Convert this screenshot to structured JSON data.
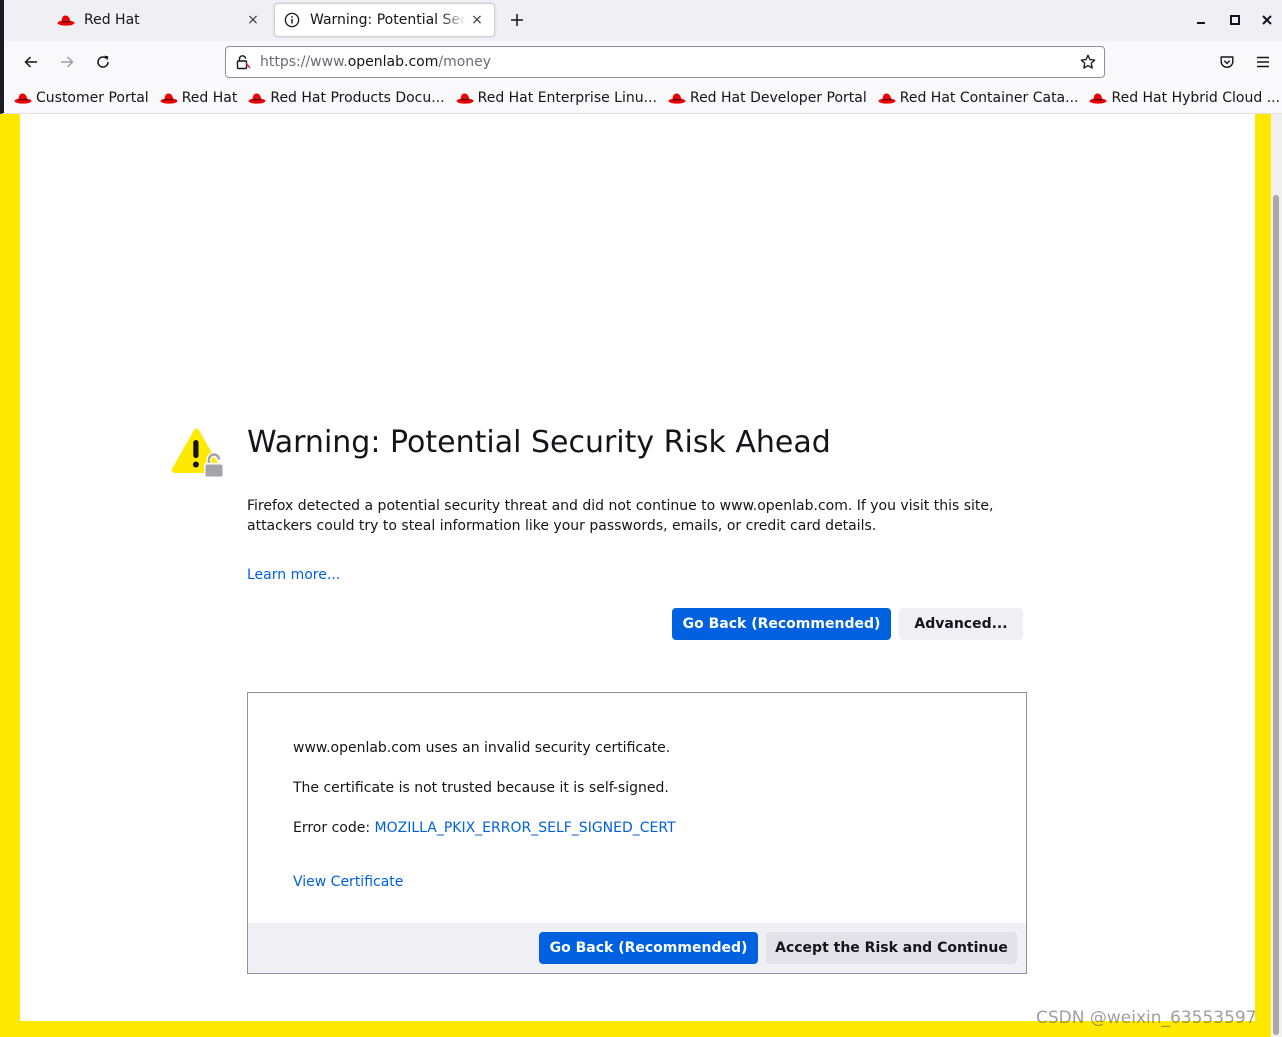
{
  "tabs": [
    {
      "title": "Red Hat",
      "favicon": "redhat-icon",
      "close": "×"
    },
    {
      "title": "Warning: Potential Security Risk Ahead",
      "favicon": "info-icon",
      "close": "×"
    }
  ],
  "toolbar": {
    "url_prefix": "https://www.",
    "url_domain": "openlab.com",
    "url_path": "/money"
  },
  "bookmarks": [
    {
      "label": "Customer Portal"
    },
    {
      "label": "Red Hat"
    },
    {
      "label": "Red Hat Products Docu..."
    },
    {
      "label": "Red Hat Enterprise Linu..."
    },
    {
      "label": "Red Hat Developer Portal"
    },
    {
      "label": "Red Hat Container Cata..."
    },
    {
      "label": "Red Hat Hybrid Cloud ..."
    }
  ],
  "page": {
    "title": "Warning: Potential Security Risk Ahead",
    "description": "Firefox detected a potential security threat and did not continue to www.openlab.com. If you visit this site, attackers could try to steal information like your passwords, emails, or credit card details.",
    "learn_more": "Learn more...",
    "go_back": "Go Back (Recommended)",
    "advanced": "Advanced..."
  },
  "advanced": {
    "line1": "www.openlab.com uses an invalid security certificate.",
    "line2": "The certificate is not trusted because it is self-signed.",
    "error_label": "Error code: ",
    "error_code": "MOZILLA_PKIX_ERROR_SELF_SIGNED_CERT",
    "view_certificate": "View Certificate",
    "go_back": "Go Back (Recommended)",
    "accept": "Accept the Risk and Continue"
  },
  "watermark": "CSDN @weixin_63553597",
  "colors": {
    "accent": "#0061e0",
    "border_yellow": "#ffe900",
    "redhat_red": "#ee0000"
  }
}
